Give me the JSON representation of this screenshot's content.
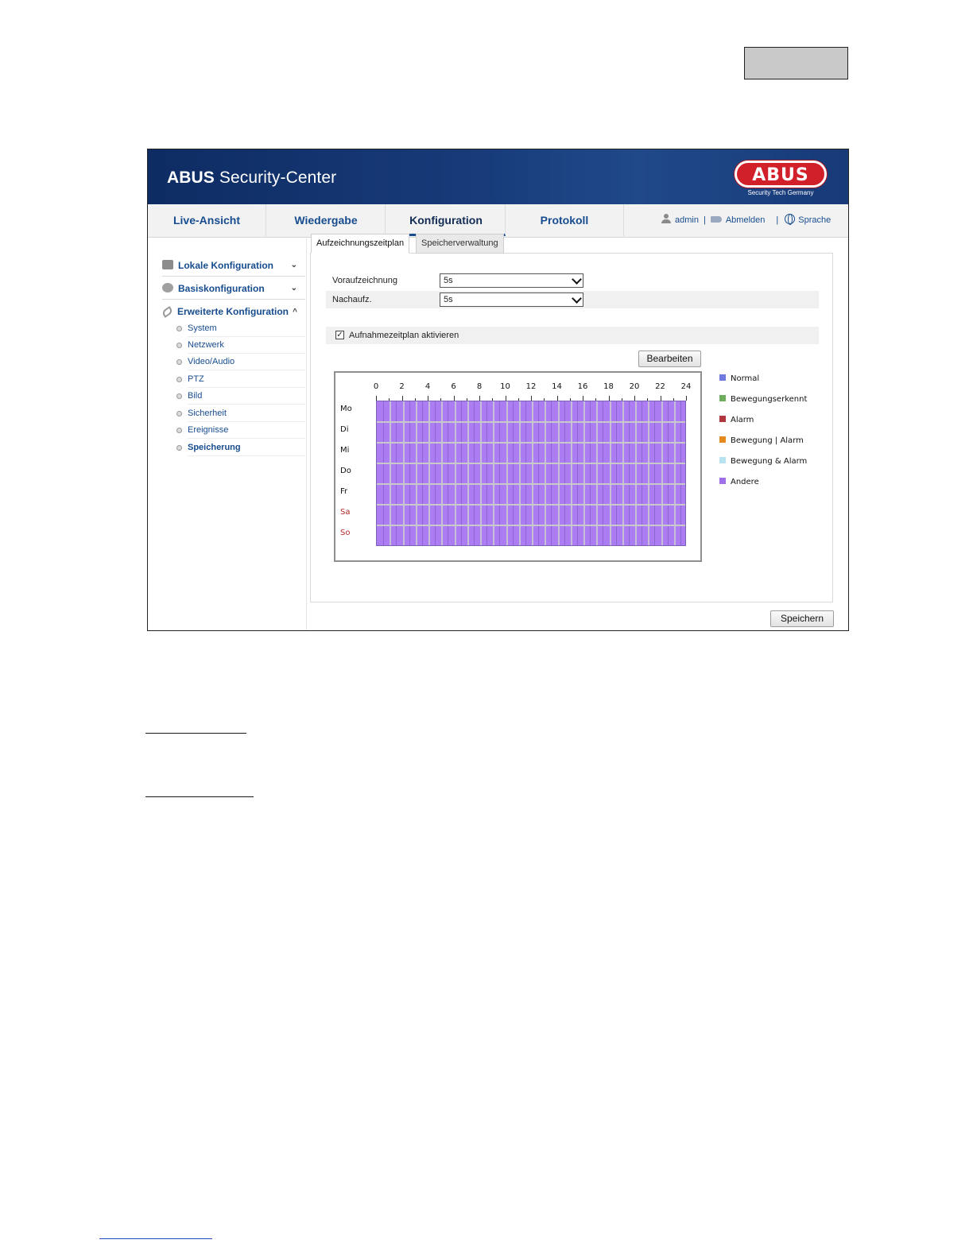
{
  "app": {
    "title_bold": "ABUS",
    "title_rest": " Security-Center",
    "logo_text": "ABUS",
    "logo_tagline": "Security Tech Germany"
  },
  "nav": {
    "tabs": [
      {
        "label": "Live-Ansicht",
        "active": false
      },
      {
        "label": "Wiedergabe",
        "active": false
      },
      {
        "label": "Konfiguration",
        "active": true
      },
      {
        "label": "Protokoll",
        "active": false
      }
    ],
    "user": "admin",
    "logout": "Abmelden",
    "language": "Sprache",
    "separator": "|"
  },
  "sidebar": {
    "groups": [
      {
        "label": "Lokale Konfiguration",
        "icon": "camera-icon",
        "chevron": "⌄"
      },
      {
        "label": "Basiskonfiguration",
        "icon": "gear-icon",
        "chevron": "⌄"
      },
      {
        "label": "Erweiterte Konfiguration",
        "icon": "wrench-icon",
        "chevron": "^"
      }
    ],
    "items": [
      {
        "label": "System"
      },
      {
        "label": "Netzwerk"
      },
      {
        "label": "Video/Audio"
      },
      {
        "label": "PTZ"
      },
      {
        "label": "Bild"
      },
      {
        "label": "Sicherheit"
      },
      {
        "label": "Ereignisse"
      },
      {
        "label": "Speicherung",
        "active": true
      }
    ]
  },
  "subtabs": [
    {
      "label": "Aufzeichnungszeitplan",
      "active": true
    },
    {
      "label": "Speicherverwaltung",
      "active": false
    }
  ],
  "form": {
    "pre_record_label": "Voraufzeichnung",
    "pre_record_value": "5s",
    "post_record_label": "Nachaufz.",
    "post_record_value": "5s",
    "enable_schedule_label": "Aufnahmezeitplan aktivieren",
    "enable_schedule_checked": true,
    "checkmark": "✓",
    "edit_button": "Bearbeiten",
    "save_button": "Speichern"
  },
  "schedule": {
    "hours": [
      "0",
      "2",
      "4",
      "6",
      "8",
      "10",
      "12",
      "14",
      "16",
      "18",
      "20",
      "22",
      "24"
    ],
    "days": [
      {
        "label": "Mo",
        "weekend": false
      },
      {
        "label": "Di",
        "weekend": false
      },
      {
        "label": "Mi",
        "weekend": false
      },
      {
        "label": "Do",
        "weekend": false
      },
      {
        "label": "Fr",
        "weekend": false
      },
      {
        "label": "Sa",
        "weekend": true
      },
      {
        "label": "So",
        "weekend": true
      }
    ],
    "fill_type": "Andere",
    "fill_color": "#ab7cf2"
  },
  "legend": [
    {
      "label": "Normal",
      "color": "#6f79e0"
    },
    {
      "label": "Bewegungserkennt",
      "color": "#6cad5e"
    },
    {
      "label": "Alarm",
      "color": "#b0363f"
    },
    {
      "label": "Bewegung | Alarm",
      "color": "#e58a1f"
    },
    {
      "label": "Bewegung & Alarm",
      "color": "#b6e2f2"
    },
    {
      "label": "Andere",
      "color": "#9f6ee8"
    }
  ]
}
